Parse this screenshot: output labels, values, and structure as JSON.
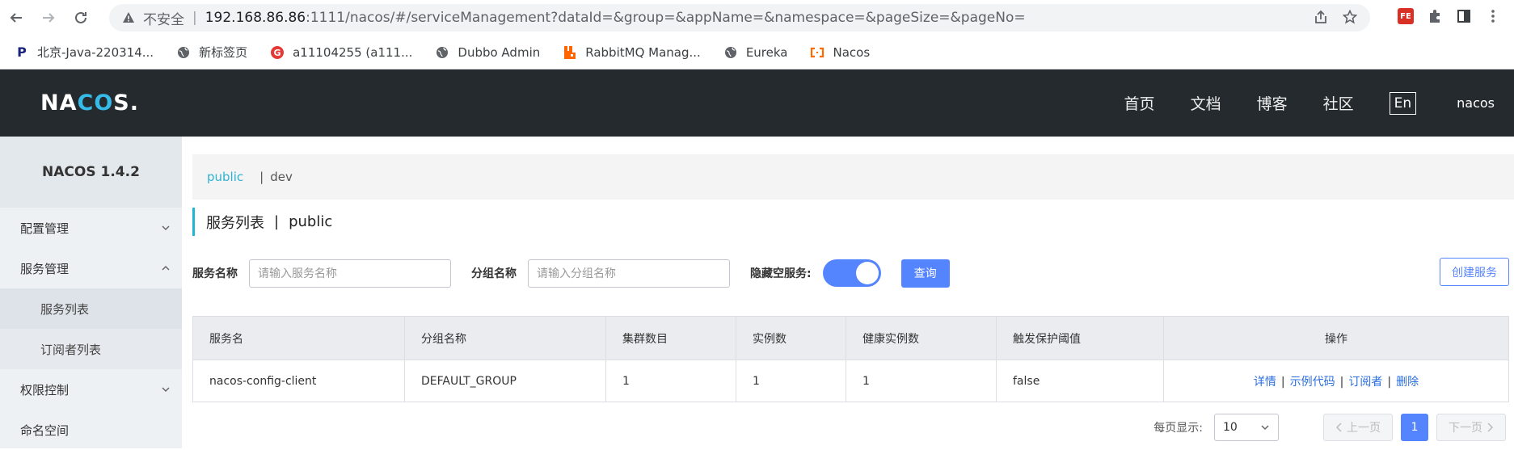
{
  "browser": {
    "insecure_label": "不安全",
    "url_host": "192.168.86.86",
    "url_rest": ":1111/nacos/#/serviceManagement?dataId=&group=&appName=&namespace=&pageSize=&pageNo=",
    "bookmarks": [
      {
        "label": "北京-Java-220314...",
        "icon": "p-logo-icon"
      },
      {
        "label": "新标签页",
        "icon": "globe-icon"
      },
      {
        "label": "a11104255 (a111...",
        "icon": "g-logo-icon"
      },
      {
        "label": "Dubbo Admin",
        "icon": "globe-icon"
      },
      {
        "label": "RabbitMQ Manag...",
        "icon": "rabbitmq-icon"
      },
      {
        "label": "Eureka",
        "icon": "globe-icon"
      },
      {
        "label": "Nacos",
        "icon": "nacos-icon"
      }
    ]
  },
  "header": {
    "logo_left": "NA",
    "logo_mid": "CO",
    "logo_right": "S.",
    "nav": [
      "首页",
      "文档",
      "博客",
      "社区"
    ],
    "lang": "En",
    "user": "nacos"
  },
  "sidebar": {
    "title": "NACOS 1.4.2",
    "items": [
      {
        "label": "配置管理"
      },
      {
        "label": "服务管理"
      },
      {
        "label": "服务列表"
      },
      {
        "label": "订阅者列表"
      },
      {
        "label": "权限控制"
      },
      {
        "label": "命名空间"
      }
    ]
  },
  "namespace": {
    "active": "public",
    "other": "dev"
  },
  "page": {
    "title": "服务列表",
    "separator": "|",
    "namespace": "public"
  },
  "filter": {
    "service_label": "服务名称",
    "service_placeholder": "请输入服务名称",
    "group_label": "分组名称",
    "group_placeholder": "请输入分组名称",
    "hide_empty_label": "隐藏空服务:",
    "query_button": "查询",
    "create_button": "创建服务"
  },
  "table": {
    "headers": [
      "服务名",
      "分组名称",
      "集群数目",
      "实例数",
      "健康实例数",
      "触发保护阈值",
      "操作"
    ],
    "rows": [
      {
        "name": "nacos-config-client",
        "group": "DEFAULT_GROUP",
        "clusters": "1",
        "instances": "1",
        "healthy": "1",
        "threshold": "false"
      }
    ],
    "ops": [
      "详情",
      "示例代码",
      "订阅者",
      "删除"
    ]
  },
  "pager": {
    "label": "每页显示:",
    "page_size": "10",
    "prev": "上一页",
    "current": "1",
    "next": "下一页"
  },
  "colors": {
    "primary": "#5584ff",
    "header_bg": "#252a2f",
    "accent": "#1fb6d6"
  }
}
